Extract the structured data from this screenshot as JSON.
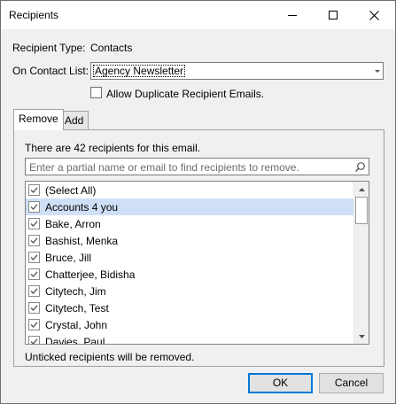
{
  "window": {
    "title": "Recipients"
  },
  "form": {
    "recipient_type_label": "Recipient Type:",
    "recipient_type_value": "Contacts",
    "contact_list_label": "On Contact List:",
    "contact_list_value": "Agency Newsletter",
    "allow_duplicates_label": "Allow Duplicate Recipient Emails.",
    "allow_duplicates_checked": false
  },
  "tabs": [
    {
      "label": "Remove",
      "active": true
    },
    {
      "label": "Add",
      "active": false
    }
  ],
  "remove_tab": {
    "count_text": "There are 42 recipients for this email.",
    "search_placeholder": "Enter a partial name or email to find recipients to remove.",
    "footer_text": "Unticked recipients will be removed.",
    "items": [
      {
        "label": "(Select All)",
        "checked": true,
        "selected": false
      },
      {
        "label": "Accounts 4 you",
        "checked": true,
        "selected": true
      },
      {
        "label": "Bake, Arron",
        "checked": true,
        "selected": false
      },
      {
        "label": "Bashist, Menka",
        "checked": true,
        "selected": false
      },
      {
        "label": "Bruce, Jill",
        "checked": true,
        "selected": false
      },
      {
        "label": "Chatterjee, Bidisha",
        "checked": true,
        "selected": false
      },
      {
        "label": "Citytech, Jim",
        "checked": true,
        "selected": false
      },
      {
        "label": "Citytech, Test",
        "checked": true,
        "selected": false
      },
      {
        "label": "Crystal, John",
        "checked": true,
        "selected": false
      },
      {
        "label": "Davies, Paul",
        "checked": true,
        "selected": false
      }
    ]
  },
  "buttons": {
    "ok": "OK",
    "cancel": "Cancel"
  },
  "colors": {
    "selection": "#cfdff5",
    "default_button_border": "#0078d7"
  }
}
